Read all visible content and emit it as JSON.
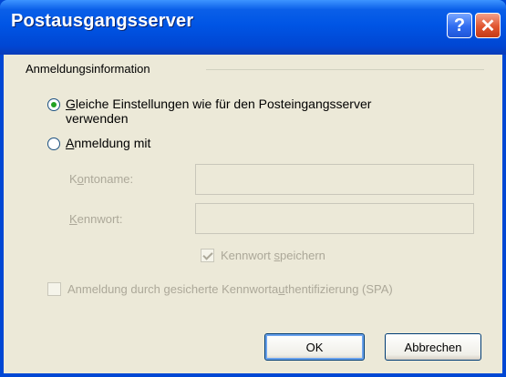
{
  "window": {
    "title": "Postausgangsserver"
  },
  "titlebar": {
    "help_glyph": "?",
    "close_glyph": "✕"
  },
  "group": {
    "label": "Anmeldungsinformation"
  },
  "options": {
    "same_settings": {
      "label_prefix": "",
      "mnemonic": "G",
      "label_rest": "leiche Einstellungen wie für den Posteingangsserver",
      "label_line2": "verwenden",
      "checked": true
    },
    "login_with": {
      "mnemonic": "A",
      "label_rest": "nmeldung mit",
      "checked": false
    }
  },
  "fields": {
    "account": {
      "label_a": "K",
      "mnemonic": "o",
      "label_b": "ntoname:",
      "value": ""
    },
    "password": {
      "mnemonic": "K",
      "label_rest": "ennwort:",
      "value": ""
    }
  },
  "save_password": {
    "label_a": "Kennwort ",
    "mnemonic": "s",
    "label_b": "peichern",
    "checked": true,
    "enabled": false
  },
  "spa": {
    "label_a": "Anmeldung durch gesicherte Kennworta",
    "mnemonic": "u",
    "label_b": "thentifizierung (SPA)",
    "checked": false,
    "enabled": false
  },
  "buttons": {
    "ok": "OK",
    "cancel": "Abbrechen"
  }
}
